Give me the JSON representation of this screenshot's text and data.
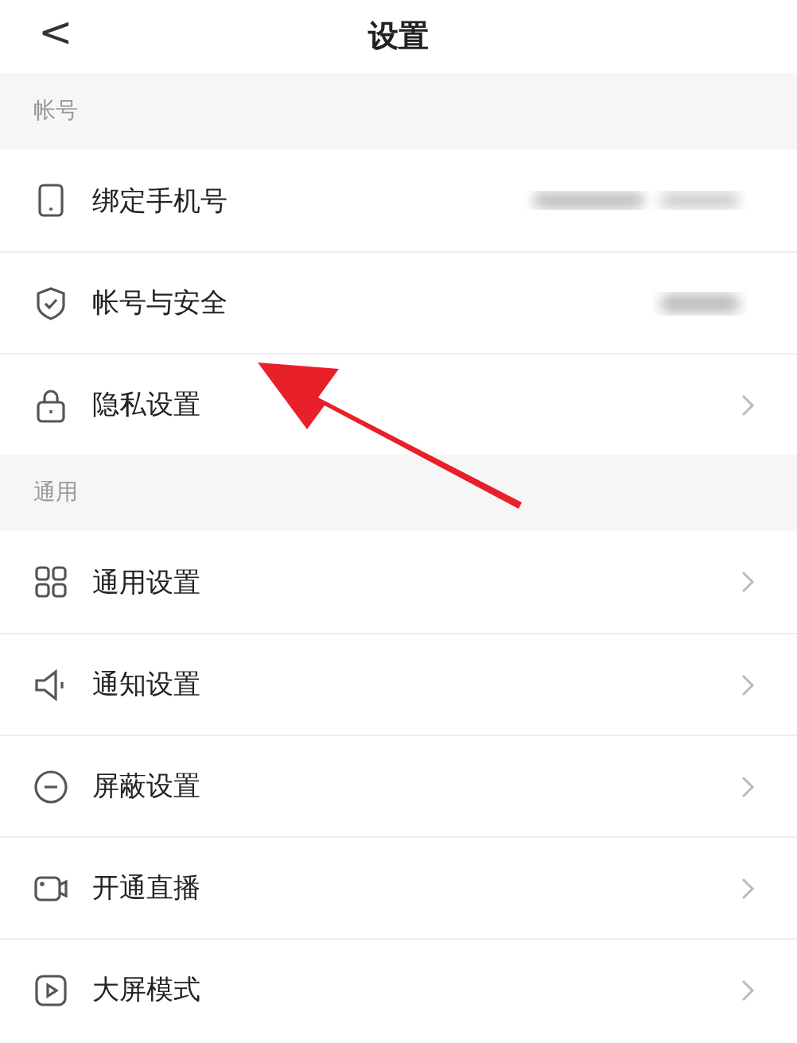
{
  "header": {
    "back": "<",
    "title": "设置"
  },
  "sections": [
    {
      "title": "帐号",
      "rows": [
        {
          "kind": "phone",
          "label": "绑定手机号",
          "blurred": true
        },
        {
          "kind": "shield",
          "label": "帐号与安全",
          "blurred": true
        },
        {
          "kind": "lock",
          "label": "隐私设置",
          "blurred": false
        }
      ]
    },
    {
      "title": "通用",
      "rows": [
        {
          "kind": "grid",
          "label": "通用设置",
          "blurred": false
        },
        {
          "kind": "speaker",
          "label": "通知设置",
          "blurred": false
        },
        {
          "kind": "minus",
          "label": "屏蔽设置",
          "blurred": false
        },
        {
          "kind": "video",
          "label": "开通直播",
          "blurred": false
        },
        {
          "kind": "play",
          "label": "大屏模式",
          "blurred": false
        }
      ]
    }
  ],
  "annotation": {
    "kind": "arrow"
  }
}
